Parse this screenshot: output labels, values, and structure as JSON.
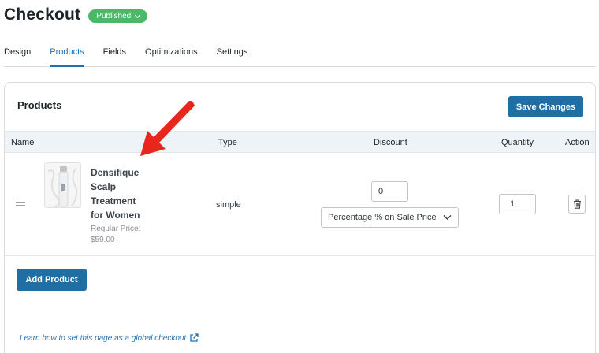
{
  "header": {
    "title": "Checkout",
    "status": "Published"
  },
  "tabs": [
    {
      "label": "Design",
      "active": false
    },
    {
      "label": "Products",
      "active": true
    },
    {
      "label": "Fields",
      "active": false
    },
    {
      "label": "Optimizations",
      "active": false
    },
    {
      "label": "Settings",
      "active": false
    }
  ],
  "products_panel": {
    "title": "Products",
    "save_label": "Save Changes",
    "columns": [
      "Name",
      "Type",
      "Discount",
      "Quantity",
      "Action"
    ],
    "rows": [
      {
        "name": "Densifique Scalp Treatment for Women",
        "price_label": "Regular Price: $59.00",
        "type": "simple",
        "discount_value": "0",
        "discount_type": "Percentage % on Sale Price",
        "quantity": "1"
      }
    ],
    "add_label": "Add Product",
    "global_link": "Learn how to set this page as a global checkout"
  },
  "colors": {
    "accent": "#2271b1",
    "button": "#1f6fa5",
    "badge": "#4ab866",
    "annotation_arrow": "#e8261c"
  }
}
